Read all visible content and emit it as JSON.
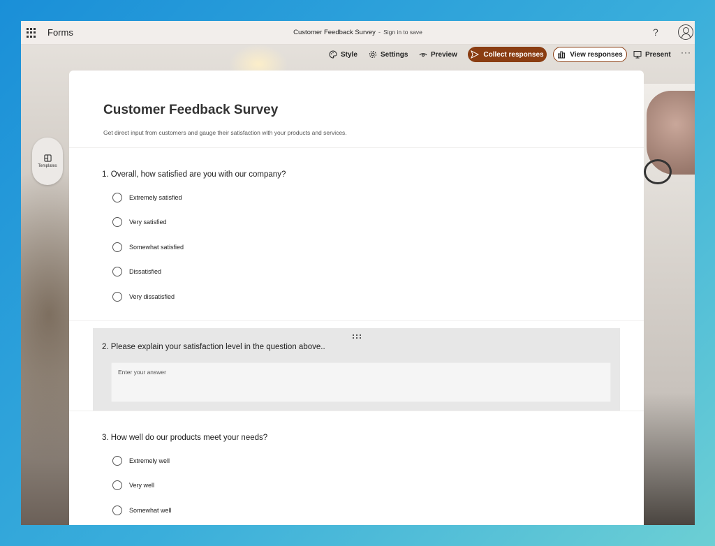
{
  "app": {
    "name": "Forms"
  },
  "document": {
    "title": "Customer Feedback Survey",
    "separator": "-",
    "save_hint": "Sign in to save"
  },
  "header": {
    "help_label": "?"
  },
  "toolbar": {
    "style_label": "Style",
    "settings_label": "Settings",
    "preview_label": "Preview",
    "collect_label": "Collect responses",
    "view_label": "View responses",
    "present_label": "Present",
    "more_label": "···"
  },
  "sidebar": {
    "templates_label": "Templates"
  },
  "form": {
    "title": "Customer Feedback Survey",
    "description": "Get direct input from customers and gauge their satisfaction with your products and services.",
    "questions": [
      {
        "title": "1. Overall, how satisfied are you with our company?",
        "options": [
          "Extremely satisfied",
          "Very satisfied",
          "Somewhat satisfied",
          "Dissatisfied",
          "Very dissatisfied"
        ]
      },
      {
        "title": "2. Please explain your satisfaction level in the question above..",
        "placeholder": "Enter your answer"
      },
      {
        "title": "3. How well do our products meet your needs?",
        "options": [
          "Extremely well",
          "Very well",
          "Somewhat well"
        ]
      }
    ]
  },
  "colors": {
    "accent": "#8a3d12",
    "page_bg": "#1a8fd8"
  }
}
